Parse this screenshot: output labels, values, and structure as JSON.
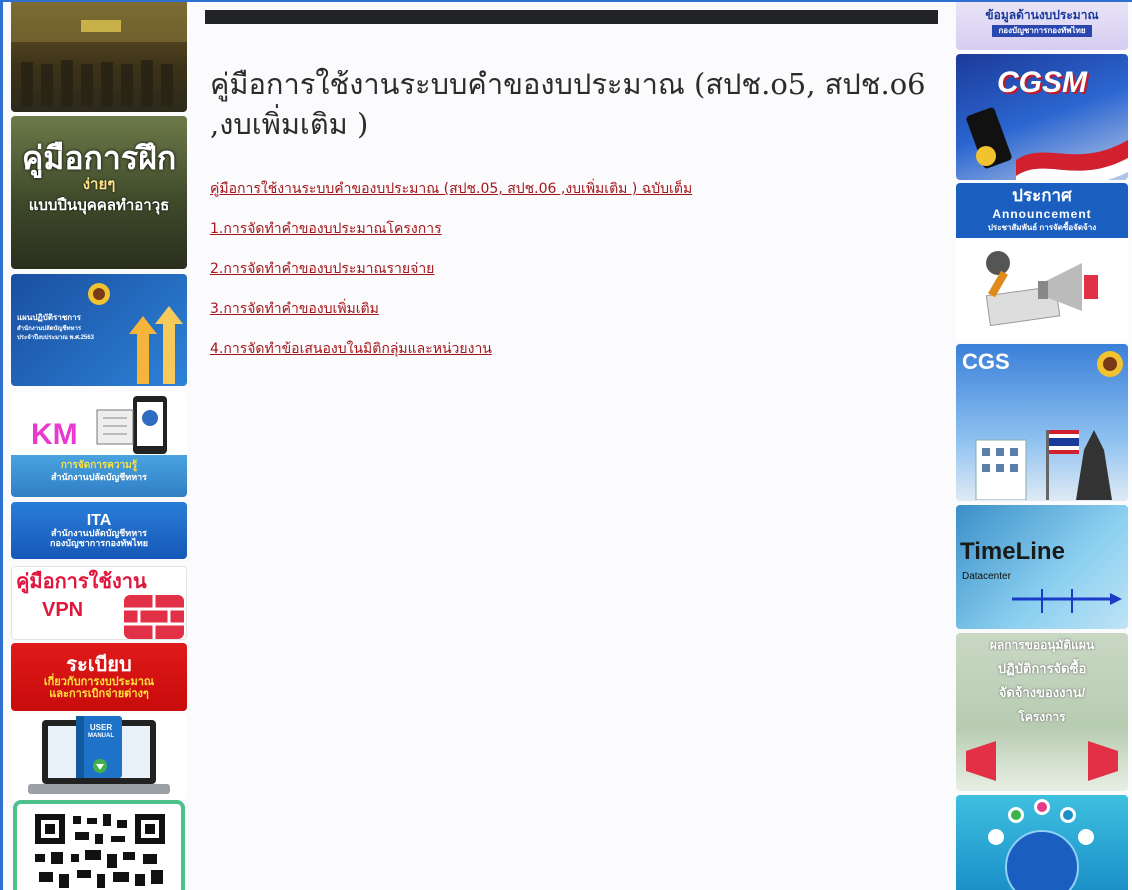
{
  "page": {
    "title": "คู่มือการใช้งานระบบคำของบประมาณ (สปช.o5, สปช.o6 ,งบเพิ่มเติม )",
    "links": [
      "คู่มือการใช้งานระบบคำของบประมาณ (สปช.05, สปช.06 ,งบเพิ่มเติม ) ฉบับเต็ม",
      "1.การจัดทำคำของบประมาณโครงการ",
      "2.การจัดทำคำของบประมาณรายจ่าย",
      "3.การจัดทำคำของบเพิ่มเติม",
      "4.การจัดทำข้อเสนองบในมิติกลุ่มและหน่วยงาน"
    ]
  },
  "left_banners": {
    "manual_training": {
      "line1": "คู่มือการฝึก",
      "line2": "ง่ายๆ",
      "line3": "แบบปืนบุคคลทำอาวุธ"
    },
    "action_plan": {
      "line1": "แผนปฏิบัติราชการ",
      "line2": "สำนักงานปลัดบัญชีทหาร",
      "line3": "ประจำปีงบประมาณ พ.ศ.2563"
    },
    "km": {
      "line1": "KM",
      "line2": "การจัดการความรู้",
      "line3": "สำนักงานปลัดบัญชีทหาร"
    },
    "ita": {
      "line1": "ITA",
      "line2": "สำนักงานปลัดบัญชีทหาร",
      "line3": "กองบัญชาการกองทัพไทย"
    },
    "vpn": {
      "line1": "คู่มือการใช้งาน",
      "line2": "VPN"
    },
    "regulation": {
      "line1": "ระเบียบ",
      "line2": "เกี่ยวกับการงบประมาณ",
      "line3": "และการเบิกจ่ายต่างๆ"
    },
    "user_manual": {
      "line1": "USER",
      "line2": "MANUAL"
    }
  },
  "right_banners": {
    "budget_info": {
      "line1": "ข้อมูลด้านงบประมาณ",
      "line2": "กองบัญชาการกองทัพไทย"
    },
    "cgsm": {
      "label": "CGSM"
    },
    "announcement": {
      "line1": "ประกาศ",
      "line2": "Announcement",
      "line3": "ประชาสัมพันธ์ การจัดซื้อจัดจ้าง"
    },
    "cgs": {
      "label": "CGS"
    },
    "timeline": {
      "line1": "TimeLine",
      "line2": "Datacenter"
    },
    "procurement": {
      "line1": "ผลการขออนุมัติแผน",
      "line2": "ปฏิบัติการจัดซื้อ",
      "line3": "จัดจ้างของงาน/",
      "line4": "โครงการ"
    }
  },
  "colors": {
    "link": "#a4161a",
    "title": "#2c2c2c",
    "frame_border": "#2f6fd0",
    "top_bar": "#222326"
  }
}
